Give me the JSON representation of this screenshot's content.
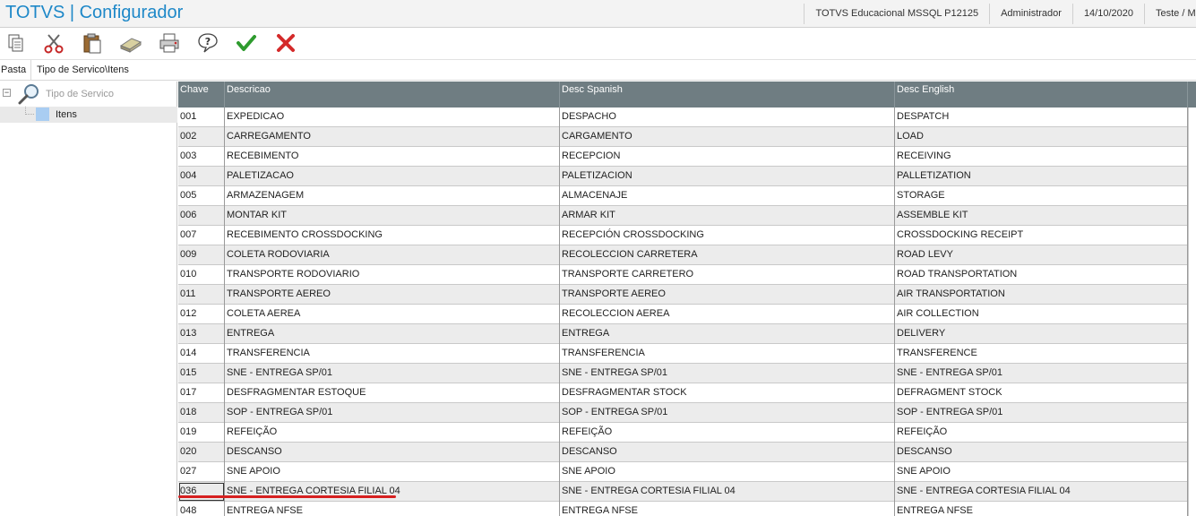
{
  "title_bar": {
    "app_title": "TOTVS | Configurador",
    "environment": "TOTVS Educacional MSSQL P12125",
    "user": "Administrador",
    "date": "14/10/2020",
    "company": "Teste / Mat"
  },
  "toolbar": {
    "buttons": [
      {
        "name": "copy-icon",
        "tooltip": ""
      },
      {
        "name": "cut-icon",
        "tooltip": ""
      },
      {
        "name": "paste-icon",
        "tooltip": ""
      },
      {
        "name": "eraser-icon",
        "tooltip": ""
      },
      {
        "name": "print-icon",
        "tooltip": ""
      },
      {
        "name": "help-icon",
        "tooltip": ""
      },
      {
        "name": "confirm-icon",
        "tooltip": ""
      },
      {
        "name": "cancel-icon",
        "tooltip": ""
      }
    ],
    "colors": {
      "confirm": "#2e9b2e",
      "cancel": "#d42a2a"
    }
  },
  "path_bar": {
    "label": "Pasta",
    "value": "Tipo de Servico\\Itens"
  },
  "tree": {
    "root_label": "Tipo de Servico",
    "child_label": "Itens"
  },
  "grid": {
    "columns": [
      "Chave",
      "Descricao",
      "Desc Spanish",
      "Desc English"
    ],
    "rows": [
      [
        "001",
        "EXPEDICAO",
        "DESPACHO",
        "DESPATCH"
      ],
      [
        "002",
        "CARREGAMENTO",
        "CARGAMENTO",
        "LOAD"
      ],
      [
        "003",
        "RECEBIMENTO",
        "RECEPCION",
        "RECEIVING"
      ],
      [
        "004",
        "PALETIZACAO",
        "PALETIZACION",
        "PALLETIZATION"
      ],
      [
        "005",
        "ARMAZENAGEM",
        "ALMACENAJE",
        "STORAGE"
      ],
      [
        "006",
        "MONTAR KIT",
        "ARMAR KIT",
        "ASSEMBLE KIT"
      ],
      [
        "007",
        "RECEBIMENTO CROSSDOCKING",
        "RECEPCIÓN CROSSDOCKING",
        "CROSSDOCKING RECEIPT"
      ],
      [
        "009",
        "COLETA RODOVIARIA",
        "RECOLECCION CARRETERA",
        "ROAD LEVY"
      ],
      [
        "010",
        "TRANSPORTE RODOVIARIO",
        "TRANSPORTE CARRETERO",
        "ROAD TRANSPORTATION"
      ],
      [
        "011",
        "TRANSPORTE AEREO",
        "TRANSPORTE AEREO",
        "AIR TRANSPORTATION"
      ],
      [
        "012",
        "COLETA AEREA",
        "RECOLECCION AEREA",
        "AIR COLLECTION"
      ],
      [
        "013",
        "ENTREGA",
        "ENTREGA",
        "DELIVERY"
      ],
      [
        "014",
        "TRANSFERENCIA",
        "TRANSFERENCIA",
        "TRANSFERENCE"
      ],
      [
        "015",
        "SNE - ENTREGA SP/01",
        "SNE - ENTREGA SP/01",
        "SNE - ENTREGA SP/01"
      ],
      [
        "017",
        "DESFRAGMENTAR ESTOQUE",
        "DESFRAGMENTAR STOCK",
        "DEFRAGMENT STOCK"
      ],
      [
        "018",
        "SOP - ENTREGA SP/01",
        "SOP - ENTREGA SP/01",
        "SOP - ENTREGA SP/01"
      ],
      [
        "019",
        "REFEIÇÃO",
        "REFEIÇÃO",
        "REFEIÇÃO"
      ],
      [
        "020",
        "DESCANSO",
        "DESCANSO",
        "DESCANSO"
      ],
      [
        "027",
        "SNE APOIO",
        "SNE APOIO",
        "SNE APOIO"
      ],
      [
        "036",
        "SNE - ENTREGA CORTESIA FILIAL 04",
        "SNE - ENTREGA CORTESIA FILIAL 04",
        "SNE - ENTREGA CORTESIA FILIAL 04"
      ],
      [
        "048",
        "ENTREGA NFSE",
        "ENTREGA NFSE",
        "ENTREGA NFSE"
      ]
    ],
    "selected_row_index": 19,
    "highlight_color": "#d62020"
  }
}
